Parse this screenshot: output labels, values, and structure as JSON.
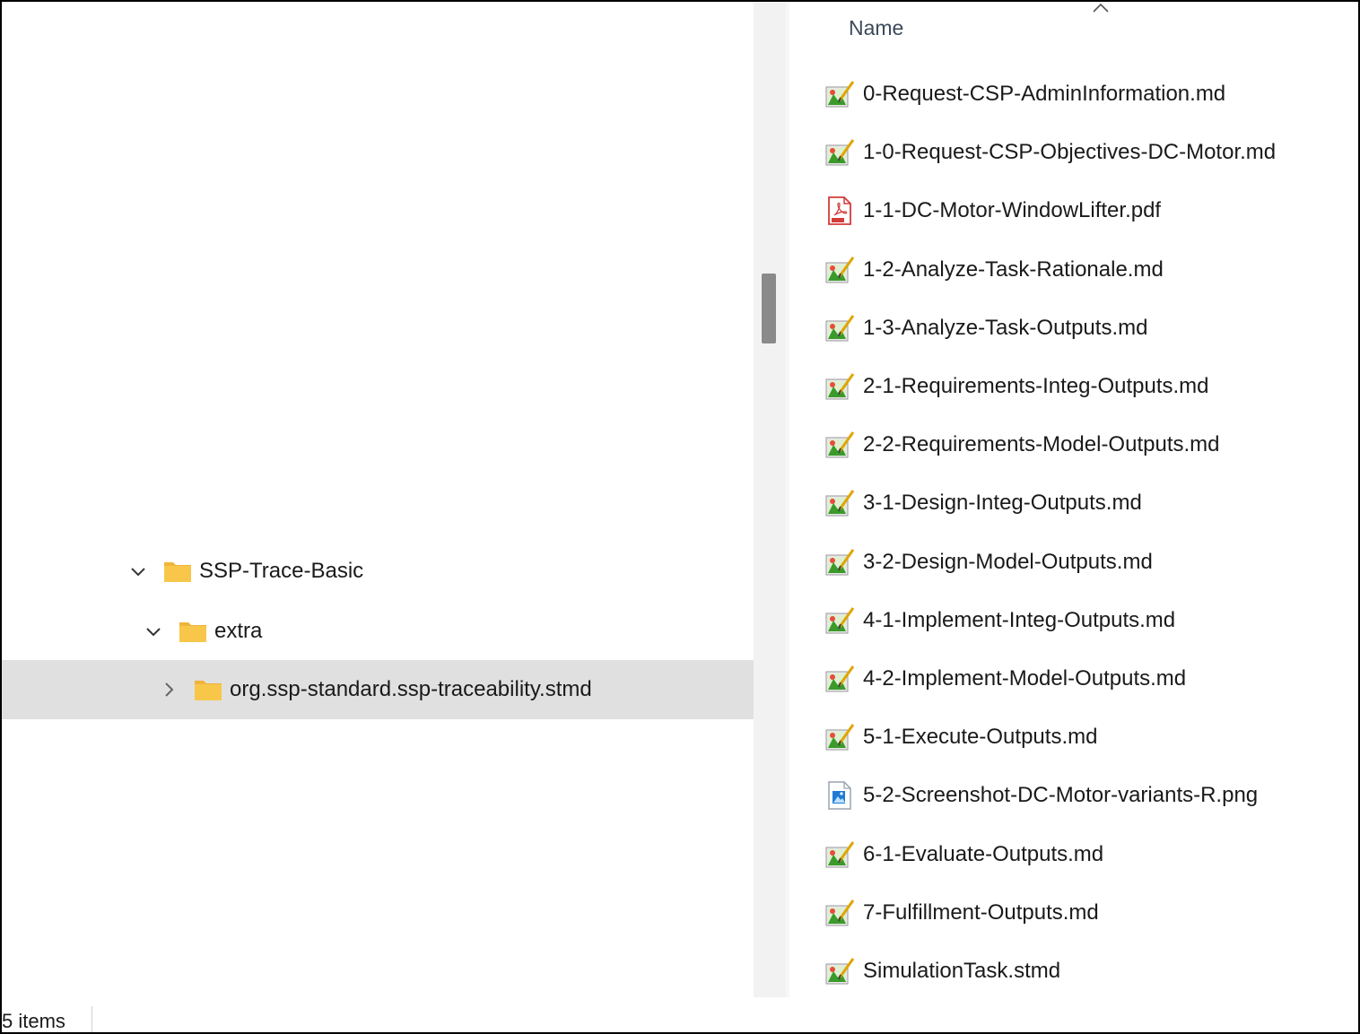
{
  "column_header": {
    "name_label": "Name"
  },
  "tree": {
    "items": [
      {
        "label": "SSP-Trace-Basic",
        "expanded": true,
        "depth": 0,
        "icon": "folder-icon"
      },
      {
        "label": "extra",
        "expanded": true,
        "depth": 1,
        "icon": "folder-icon"
      },
      {
        "label": "org.ssp-standard.ssp-traceability.stmd",
        "expanded": false,
        "selected": true,
        "depth": 2,
        "icon": "folder-icon"
      }
    ]
  },
  "files": [
    {
      "name": "0-Request-CSP-AdminInformation.md",
      "icon": "markdown-file-icon"
    },
    {
      "name": "1-0-Request-CSP-Objectives-DC-Motor.md",
      "icon": "markdown-file-icon"
    },
    {
      "name": "1-1-DC-Motor-WindowLifter.pdf",
      "icon": "pdf-file-icon"
    },
    {
      "name": "1-2-Analyze-Task-Rationale.md",
      "icon": "markdown-file-icon"
    },
    {
      "name": "1-3-Analyze-Task-Outputs.md",
      "icon": "markdown-file-icon"
    },
    {
      "name": "2-1-Requirements-Integ-Outputs.md",
      "icon": "markdown-file-icon"
    },
    {
      "name": "2-2-Requirements-Model-Outputs.md",
      "icon": "markdown-file-icon"
    },
    {
      "name": "3-1-Design-Integ-Outputs.md",
      "icon": "markdown-file-icon"
    },
    {
      "name": "3-2-Design-Model-Outputs.md",
      "icon": "markdown-file-icon"
    },
    {
      "name": "4-1-Implement-Integ-Outputs.md",
      "icon": "markdown-file-icon"
    },
    {
      "name": "4-2-Implement-Model-Outputs.md",
      "icon": "markdown-file-icon"
    },
    {
      "name": "5-1-Execute-Outputs.md",
      "icon": "markdown-file-icon"
    },
    {
      "name": "5-2-Screenshot-DC-Motor-variants-R.png",
      "icon": "image-file-icon"
    },
    {
      "name": "6-1-Evaluate-Outputs.md",
      "icon": "markdown-file-icon"
    },
    {
      "name": "7-Fulfillment-Outputs.md",
      "icon": "markdown-file-icon"
    },
    {
      "name": "SimulationTask.stmd",
      "icon": "markdown-file-icon"
    }
  ],
  "status": {
    "items_text": "5 items"
  },
  "colors": {
    "selection": "#e0e0e0",
    "folder": "#f8c74a",
    "header_text": "#3c4a5c",
    "scroll_thumb": "#8a8a8a"
  }
}
